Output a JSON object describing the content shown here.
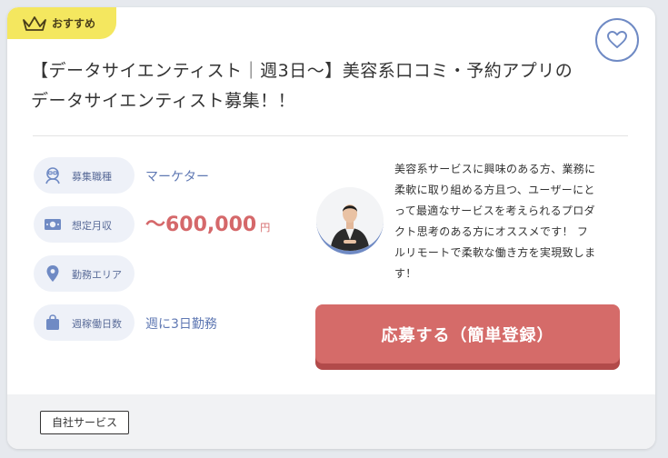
{
  "badge": {
    "label": "おすすめ",
    "icon": "crown-icon"
  },
  "favorite": {
    "icon": "heart-icon"
  },
  "job": {
    "title_line1": "【データサイエンティスト｜週3日〜】美容系口コミ・予約アプリの",
    "title_line2": "データサイエンティスト募集！！"
  },
  "details": {
    "position_label": "募集職種",
    "position_value": "マーケター",
    "salary_label": "想定月収",
    "salary_value": "〜600,000",
    "salary_unit": "円",
    "location_label": "勤務エリア",
    "workdays_label": "週稼働日数",
    "workdays_value": "週に3日勤務"
  },
  "description": {
    "line1": "美容系サービスに興味のある方、業務に",
    "line2": "柔軟に取り組める方且つ、ユーザーにと",
    "line3": "って最適なサービスを考えられるプロダ",
    "line4": "クト思考のある方にオススメです！ フ",
    "line5": "ルリモートで柔軟な働き方を実現致しま",
    "line6": "す！"
  },
  "apply_button": {
    "label": "応募する（簡単登録）"
  },
  "tags": [
    "自社サービス"
  ],
  "colors": {
    "accent_blue": "#6f8ac4",
    "salary_red": "#d5686a",
    "badge_yellow": "#f4e75f",
    "button_red": "#d56b69"
  }
}
